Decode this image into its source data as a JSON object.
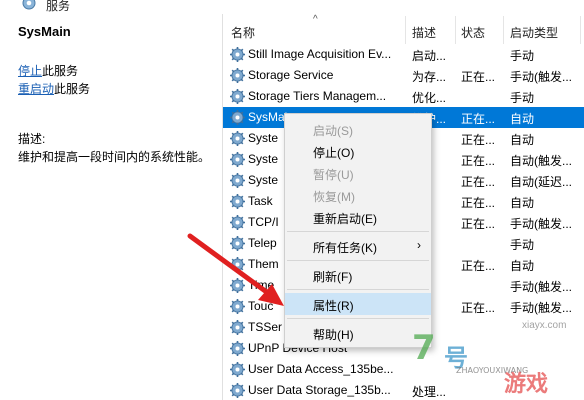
{
  "window": {
    "title": "服务"
  },
  "details": {
    "service_name": "SysMain",
    "stop_link": "停止",
    "stop_suffix": "此服务",
    "restart_link": "重启动",
    "restart_suffix": "此服务",
    "desc_label": "描述:",
    "desc_text": "维护和提高一段时间内的系统性能。"
  },
  "columns": {
    "name": "名称",
    "desc": "描述",
    "status": "状态",
    "startup": "启动类型",
    "sort_indicator": "^"
  },
  "services": [
    {
      "name": "Still Image Acquisition Ev...",
      "desc": "启动...",
      "status": "",
      "startup": "手动"
    },
    {
      "name": "Storage Service",
      "desc": "为存...",
      "status": "正在...",
      "startup": "手动(触发..."
    },
    {
      "name": "Storage Tiers Managem...",
      "desc": "优化...",
      "status": "",
      "startup": "手动"
    },
    {
      "name": "SysMain",
      "desc": "维护...",
      "status": "正在...",
      "startup": "自动",
      "selected": true
    },
    {
      "name": "Syste",
      "desc": "",
      "status": "正在...",
      "startup": "自动"
    },
    {
      "name": "Syste",
      "desc": "",
      "status": "正在...",
      "startup": "自动(触发..."
    },
    {
      "name": "Syste",
      "desc": "",
      "status": "正在...",
      "startup": "自动(延迟..."
    },
    {
      "name": "Task",
      "desc": "",
      "status": "正在...",
      "startup": "自动"
    },
    {
      "name": "TCP/I",
      "desc": "",
      "status": "正在...",
      "startup": "手动(触发..."
    },
    {
      "name": "Telep",
      "desc": "",
      "status": "",
      "startup": "手动"
    },
    {
      "name": "Them",
      "desc": "",
      "status": "正在...",
      "startup": "自动"
    },
    {
      "name": "Time",
      "desc": "",
      "status": "",
      "startup": "手动(触发..."
    },
    {
      "name": "Touc",
      "desc": "",
      "status": "正在...",
      "startup": "手动(触发..."
    },
    {
      "name": "TSSer",
      "desc": "",
      "status": "",
      "startup": ""
    },
    {
      "name": "UPnP Device Host",
      "desc": "",
      "status": "",
      "startup": ""
    },
    {
      "name": "User Data Access_135be...",
      "desc": "",
      "status": "",
      "startup": ""
    },
    {
      "name": "User Data Storage_135b...",
      "desc": "处理...",
      "status": "",
      "startup": ""
    }
  ],
  "context_menu": {
    "items": [
      {
        "label": "启动(S)",
        "disabled": true
      },
      {
        "label": "停止(O)"
      },
      {
        "label": "暂停(U)",
        "disabled": true
      },
      {
        "label": "恢复(M)",
        "disabled": true
      },
      {
        "label": "重新启动(E)"
      },
      {
        "label": "所有任务(K)",
        "submenu": true
      },
      {
        "label": "刷新(F)"
      },
      {
        "label": "属性(R)",
        "highlighted": true
      },
      {
        "label": "帮助(H)"
      }
    ],
    "submenu_arrow": "›"
  },
  "watermark": {
    "number": "7",
    "brand": "号",
    "pinyin": "ZHAOYOUXIWANG",
    "game": "游戏",
    "site": "xiayx.com"
  },
  "colors": {
    "selection": "#0078d7",
    "menu_highlight": "#cce4f7",
    "arrow": "#e02020",
    "link": "#1a5fb4"
  }
}
